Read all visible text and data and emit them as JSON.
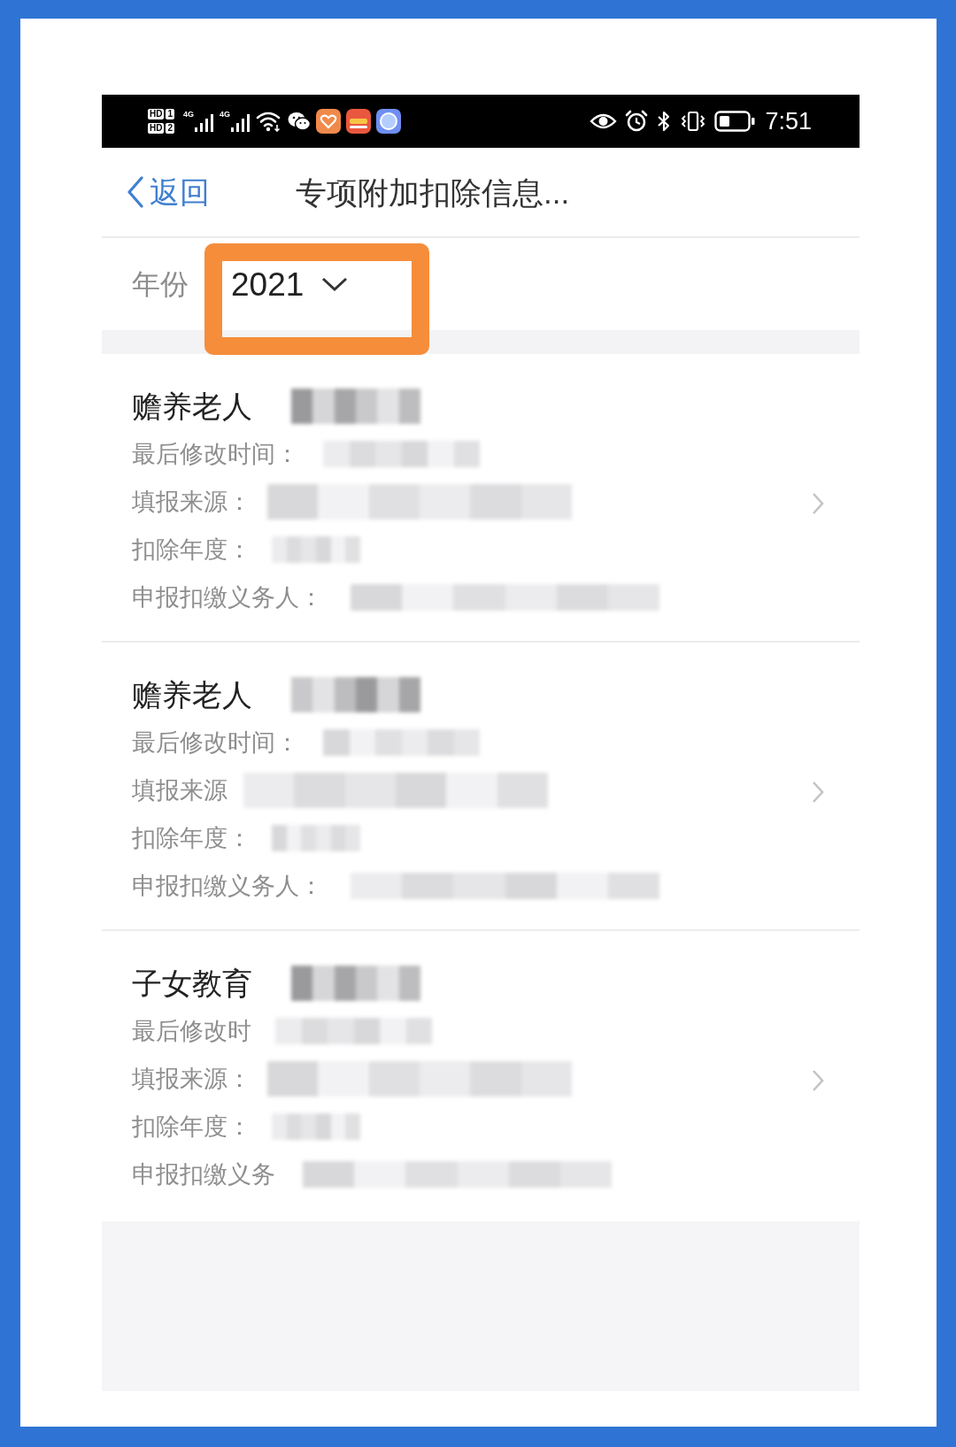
{
  "status_bar": {
    "sim_badges": [
      {
        "label": "HD",
        "slot": "1"
      },
      {
        "label": "HD",
        "slot": "2"
      }
    ],
    "network_labels": [
      "4G",
      "4G"
    ],
    "time": "7:51"
  },
  "nav_bar": {
    "back": "返回",
    "title": "专项附加扣除信息..."
  },
  "year_filter": {
    "label": "年份",
    "value": "2021",
    "highlighted": true
  },
  "records": [
    {
      "title": "赡养老人",
      "title_redacted": true,
      "fields": [
        {
          "label": "最后修改时间：",
          "redacted": true
        },
        {
          "label": "填报来源：",
          "redacted": true
        },
        {
          "label": "扣除年度：",
          "redacted": true
        },
        {
          "label": "申报扣缴义务人：",
          "redacted": true
        }
      ]
    },
    {
      "title": "赡养老人",
      "title_redacted": true,
      "fields": [
        {
          "label": "最后修改时间：",
          "redacted": true
        },
        {
          "label": "填报来源",
          "redacted": true
        },
        {
          "label": "扣除年度：",
          "redacted": true
        },
        {
          "label": "申报扣缴义务人：",
          "redacted": true
        }
      ]
    },
    {
      "title": "子女教育",
      "title_redacted": true,
      "fields": [
        {
          "label": "最后修改时",
          "redacted": true
        },
        {
          "label": "填报来源：",
          "redacted": true
        },
        {
          "label": "扣除年度：",
          "redacted": true
        },
        {
          "label": "申报扣缴义务",
          "redacted": true
        }
      ]
    }
  ]
}
